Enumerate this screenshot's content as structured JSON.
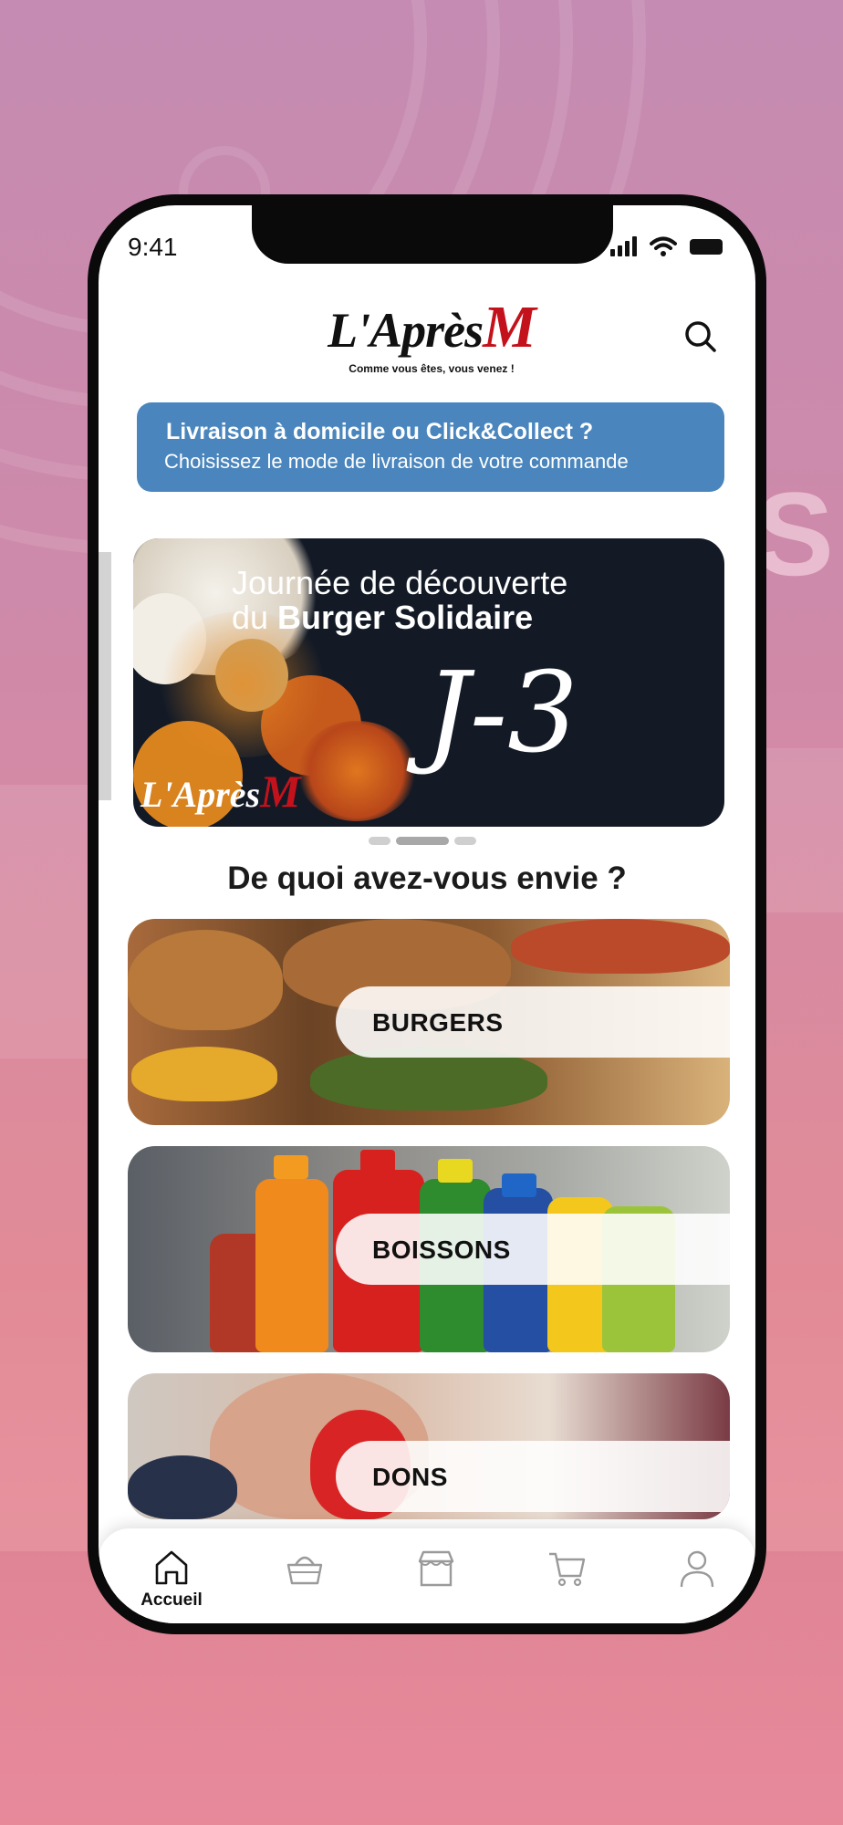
{
  "status_bar": {
    "time": "9:41"
  },
  "header": {
    "logo_text": "L'Après",
    "logo_m": "M",
    "tagline": "Comme vous êtes, vous venez !"
  },
  "delivery_banner": {
    "title": "Livraison à domicile ou Click&Collect ?",
    "subtitle": "Choisissez le mode de livraison de votre commande"
  },
  "promo_slide": {
    "line1": "Journée de découverte",
    "line2_prefix": "du ",
    "line2_bold": "Burger Solidaire",
    "countdown": "J-3",
    "logo_text": "L'Après",
    "logo_m": "M"
  },
  "carousel": {
    "slide_count": 3,
    "active_index": 1
  },
  "section_title": "De quoi avez-vous envie ?",
  "categories": [
    {
      "label": "BURGERS"
    },
    {
      "label": "BOISSONS"
    },
    {
      "label": "DONS"
    }
  ],
  "bottom_nav": [
    {
      "label": "Accueil",
      "icon": "home-icon",
      "active": true
    },
    {
      "label": "",
      "icon": "basket-icon",
      "active": false
    },
    {
      "label": "",
      "icon": "store-icon",
      "active": false
    },
    {
      "label": "",
      "icon": "cart-icon",
      "active": false
    },
    {
      "label": "",
      "icon": "user-icon",
      "active": false
    }
  ],
  "colors": {
    "banner_bg": "#4a86bd",
    "brand_red": "#c4121c",
    "background": "#c58bb2"
  }
}
